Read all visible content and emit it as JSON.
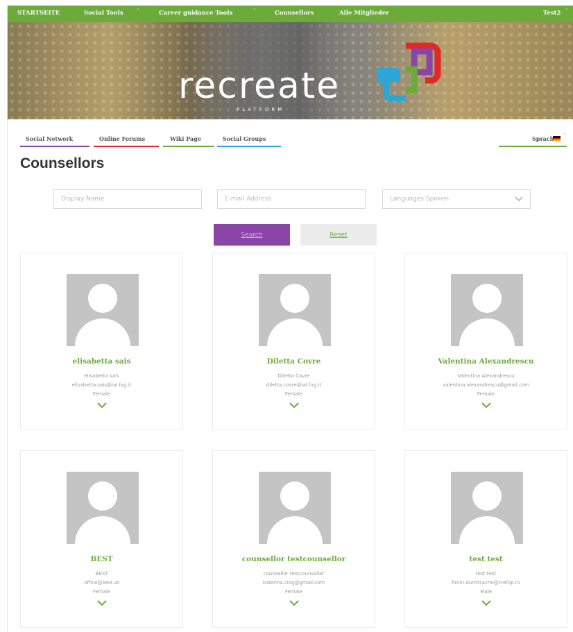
{
  "topbar": {
    "items": [
      {
        "label": "STARTSEITE",
        "has_caret": false
      },
      {
        "label": "Social Tools",
        "has_caret": true
      },
      {
        "label": "Career guidance Tools",
        "has_caret": true
      },
      {
        "label": "Counsellors",
        "has_caret": false
      },
      {
        "label": "Alle Mitglieder",
        "has_caret": false
      }
    ],
    "user": "Test2"
  },
  "banner": {
    "logo_text": "recreate",
    "logo_sub": "PLATFORM"
  },
  "tabs": [
    {
      "label": "Social Network",
      "color": "#8a45a6"
    },
    {
      "label": "Online Forums",
      "color": "#e02a2a"
    },
    {
      "label": "Wiki Page",
      "color": "#6cab3a"
    },
    {
      "label": "Social Groups",
      "color": "#2aa7d6"
    }
  ],
  "language": {
    "label": "Sprache:",
    "flag": "german-flag-icon",
    "underline_color": "#6cab3a"
  },
  "page_title": "Counsellors",
  "filters": {
    "display_name_placeholder": "Display Name",
    "email_placeholder": "E-mail Address",
    "languages_placeholder": "Languages Spoken"
  },
  "buttons": {
    "search": "Search",
    "reset": "Reset"
  },
  "colors": {
    "accent_green": "#6cab3a",
    "accent_purple": "#8a45a6"
  },
  "counsellors": [
    {
      "name": "elisabetta sais",
      "display": "elisabetta sais",
      "email": "elisabetta.sais@ial.fvg.it",
      "gender": "Female"
    },
    {
      "name": "Diletta Covre",
      "display": "Diletta Covre",
      "email": "diletta.covre@ial.fvg.it",
      "gender": "Female"
    },
    {
      "name": "Valentina Alexandrescu",
      "display": "Valentina Alexandrescu",
      "email": "valentina.alexandrescu@gmail.com",
      "gender": "Female"
    },
    {
      "name": "BEST",
      "display": "BEST",
      "email": "office@best.at",
      "gender": "Female"
    },
    {
      "name": "counsellor testcounsellor",
      "display": "counsellor testcounsellor",
      "email": "katerina.ciog@gmail.com",
      "gender": "Female"
    },
    {
      "name": "test test",
      "display": "test test",
      "email": "florin.dumitrache@crefop.ro",
      "gender": "Male"
    }
  ]
}
